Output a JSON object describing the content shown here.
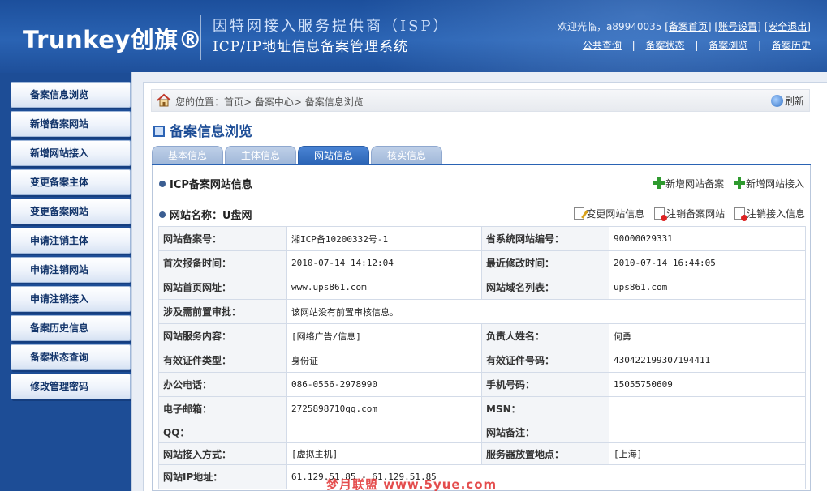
{
  "header": {
    "logo_text": "Trunkey创旗®",
    "subtitle1": "因特网接入服务提供商（ISP）",
    "subtitle2": "ICP/IP地址信息备案管理系统",
    "welcome": "欢迎光临，a89940035",
    "top_links": [
      "[备案首页]",
      "[账号设置]",
      "[安全退出]"
    ],
    "sub_nav": [
      "公共查询",
      "备案状态",
      "备案浏览",
      "备案历史"
    ],
    "sub_nav_sep": "|"
  },
  "sidebar": {
    "items": [
      {
        "label": "备案信息浏览"
      },
      {
        "label": "新增备案网站"
      },
      {
        "label": "新增网站接入"
      },
      {
        "label": "变更备案主体"
      },
      {
        "label": "变更备案网站"
      },
      {
        "label": "申请注销主体"
      },
      {
        "label": "申请注销网站"
      },
      {
        "label": "申请注销接入"
      },
      {
        "label": "备案历史信息"
      },
      {
        "label": "备案状态查询"
      },
      {
        "label": "修改管理密码"
      }
    ]
  },
  "breadcrumb": {
    "text": "您的位置：首页> 备案中心> 备案信息浏览",
    "refresh": "刷新"
  },
  "page_title": "备案信息浏览",
  "tabs": [
    {
      "label": "基本信息",
      "active": false
    },
    {
      "label": "主体信息",
      "active": false
    },
    {
      "label": "网站信息",
      "active": true
    },
    {
      "label": "核实信息",
      "active": false
    }
  ],
  "section1": {
    "title": "ICP备案网站信息",
    "actions": [
      "新增网站备案",
      "新增网站接入"
    ]
  },
  "section2": {
    "title": "网站名称：U盘网",
    "actions": [
      "变更网站信息",
      "注销备案网站",
      "注销接入信息"
    ]
  },
  "table": {
    "rows": [
      {
        "l1": "网站备案号：",
        "v1": "湘ICP备10200332号-1",
        "l2": "省系统网站编号：",
        "v2": "90000029331"
      },
      {
        "l1": "首次报备时间：",
        "v1": "2010-07-14 14:12:04",
        "l2": "最近修改时间：",
        "v2": "2010-07-14 16:44:05"
      },
      {
        "l1": "网站首页网址：",
        "v1": "www.ups861.com",
        "l2": "网站域名列表：",
        "v2": "ups861.com"
      },
      {
        "l1": "涉及需前置审批：",
        "v1": "该网站没有前置审核信息。",
        "span": true
      },
      {
        "l1": "网站服务内容：",
        "v1": "[网络广告/信息]",
        "l2": "负责人姓名：",
        "v2": "何勇"
      },
      {
        "l1": "有效证件类型：",
        "v1": "身份证",
        "l2": "有效证件号码：",
        "v2": "430422199307194411"
      },
      {
        "l1": "办公电话：",
        "v1": "086-0556-2978990",
        "l2": "手机号码：",
        "v2": "15055750609"
      },
      {
        "l1": "电子邮箱：",
        "v1": "2725898710qq.com",
        "l2": "MSN：",
        "v2": ""
      },
      {
        "l1": "QQ：",
        "v1": "",
        "l2": "网站备注：",
        "v2": ""
      },
      {
        "l1": "网站接入方式：",
        "v1": "[虚拟主机]",
        "l2": "服务器放置地点：",
        "v2": "[上海]"
      },
      {
        "l1": "网站IP地址：",
        "v1": "61.129.51.85 - 61.129.51.85",
        "span": true
      }
    ]
  },
  "watermark": "梦月联盟 www.5yue.com",
  "colors": {
    "accent": "#2a63b4",
    "header_bg": "#1d4d96",
    "action_green": "#2f9a2f"
  }
}
